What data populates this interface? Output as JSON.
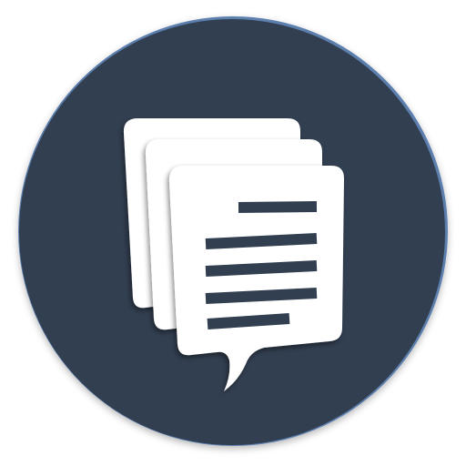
{
  "app_icon": {
    "icon": "stacked-documents-speech-bubble-icon",
    "colors": {
      "circle": "#323f51",
      "circle_rim": "#5b7fae",
      "documents": "#ffffff",
      "text_lines": "#323f51"
    }
  }
}
